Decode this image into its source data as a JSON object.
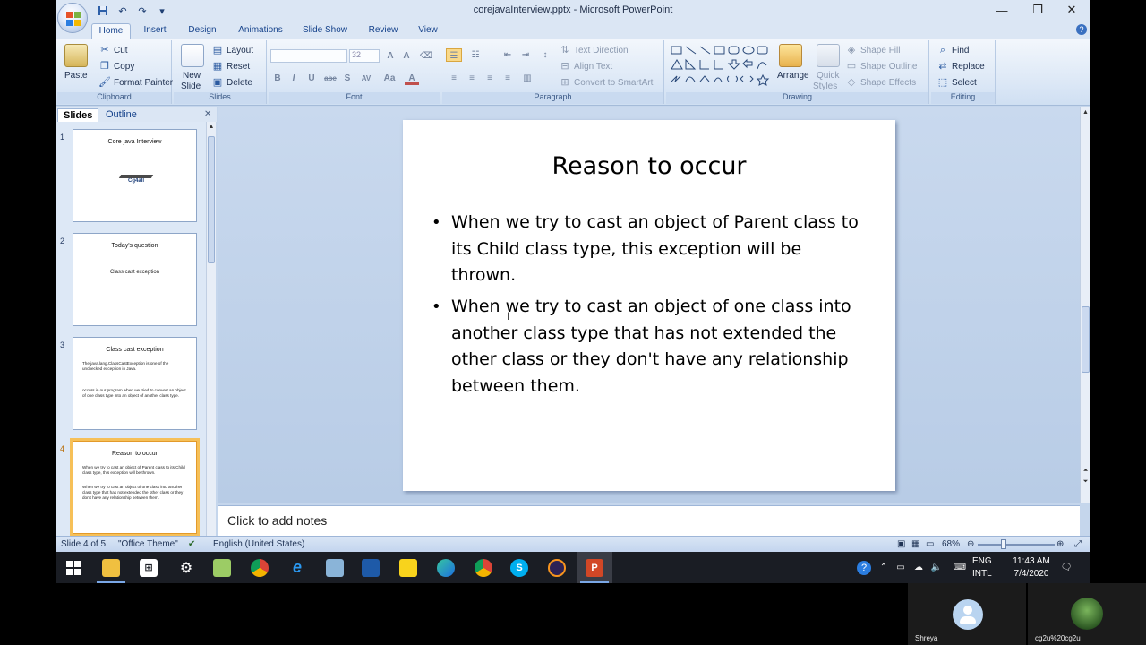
{
  "window": {
    "title": "corejavaInterview.pptx - Microsoft PowerPoint",
    "controls": [
      "minimize-icon",
      "restore-icon",
      "close-icon"
    ]
  },
  "quick_access": [
    "save-icon",
    "undo-icon",
    "redo-icon",
    "customize-icon"
  ],
  "tabs": [
    "Home",
    "Insert",
    "Design",
    "Animations",
    "Slide Show",
    "Review",
    "View"
  ],
  "active_tab": "Home",
  "ribbon": {
    "clipboard": {
      "label": "Clipboard",
      "paste": "Paste",
      "cut": "Cut",
      "copy": "Copy",
      "format_painter": "Format Painter"
    },
    "slides": {
      "label": "Slides",
      "new_slide_1": "New",
      "new_slide_2": "Slide",
      "layout": "Layout",
      "reset": "Reset",
      "delete": "Delete"
    },
    "font": {
      "label": "Font",
      "font_name": "",
      "font_size": "32",
      "bold": "B",
      "italic": "I",
      "underline": "U",
      "strike": "abe",
      "shadow": "S",
      "spacing": "AV",
      "change_case": "Aa",
      "color": "A"
    },
    "paragraph": {
      "label": "Paragraph",
      "text_direction": "Text Direction",
      "align_text": "Align Text",
      "smartart": "Convert to SmartArt"
    },
    "drawing": {
      "label": "Drawing",
      "arrange": "Arrange",
      "quick_styles_1": "Quick",
      "quick_styles_2": "Styles",
      "shape_fill": "Shape Fill",
      "shape_outline": "Shape Outline",
      "shape_effects": "Shape Effects"
    },
    "editing": {
      "label": "Editing",
      "find": "Find",
      "replace": "Replace",
      "select": "Select"
    }
  },
  "pane": {
    "tabs": [
      "Slides",
      "Outline"
    ],
    "active": "Slides",
    "thumbnails": [
      {
        "num": "1",
        "title": "Core java Interview",
        "logo": "Cg4all"
      },
      {
        "num": "2",
        "title": "Today's question",
        "sub": "Class cast exception"
      },
      {
        "num": "3",
        "title": "Class cast exception",
        "bullets": [
          "The java.lang.ClassCastException is one of the unchecked exception in Java.",
          "occurs in our program when we tried to convert an object of one class type into an object of another class type."
        ]
      },
      {
        "num": "4",
        "title": "Reason to occur",
        "bullets": [
          "When we try to cast an object of Parent class to its Child class type, this exception will be thrown.",
          "When we try to cast an object of one class into another class type that has not extended the other class or they don't have any relationship between them."
        ]
      }
    ],
    "selected_index": 3
  },
  "slide": {
    "title": "Reason to occur",
    "bullets": [
      "When we try to cast an object of Parent class to its Child class type, this exception will be thrown.",
      "When we try to cast an object of one class into another class type that has not extended the other class or they don't have any relationship between them."
    ]
  },
  "notes": {
    "placeholder": "Click to add notes"
  },
  "status": {
    "slide_info": "Slide 4 of 5",
    "theme": "\"Office Theme\"",
    "language": "English (United States)",
    "zoom": "68%"
  },
  "taskbar": {
    "apps": [
      "start-icon",
      "file-explorer-icon",
      "store-icon",
      "settings-icon",
      "notepad-plus-icon",
      "chrome-icon",
      "internet-explorer-icon",
      "app-icon",
      "ide-icon",
      "sticky-notes-icon",
      "edge-icon",
      "chrome-icon",
      "skype-icon",
      "eclipse-icon",
      "powerpoint-icon"
    ],
    "lang_1": "ENG",
    "lang_2": "INTL",
    "time": "11:43 AM",
    "date": "7/4/2020"
  },
  "video_call": {
    "participants": [
      {
        "name": "Shreya"
      },
      {
        "name": "cg2u%20cg2u"
      }
    ]
  },
  "colors": {
    "ribbon": "#dbe7f6",
    "accent": "#15428b",
    "selected_thumb": "#f6c058",
    "taskbar": "#1a1d24",
    "powerpoint": "#d24726"
  }
}
